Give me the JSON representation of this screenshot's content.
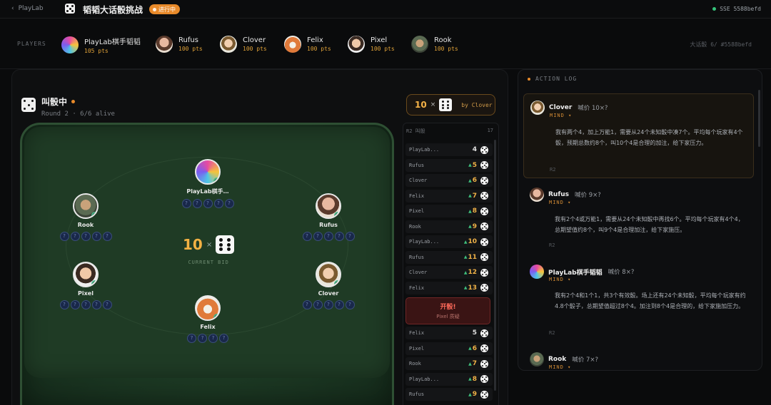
{
  "topbar": {
    "back_label": "PlayLab",
    "title": "韬韬大话骰挑战",
    "status_badge": "进行中",
    "connection": "SSE  5588befd"
  },
  "players_bar": {
    "label": "PLAYERS",
    "round_info": "大话骰  6/  #5588befd",
    "players": [
      {
        "name": "PlayLab棋手韬韬",
        "points": "105 pts"
      },
      {
        "name": "Rufus",
        "points": "100 pts"
      },
      {
        "name": "Clover",
        "points": "100 pts"
      },
      {
        "name": "Felix",
        "points": "100 pts"
      },
      {
        "name": "Pixel",
        "points": "100 pts"
      },
      {
        "name": "Rook",
        "points": "100 pts"
      }
    ]
  },
  "phase": {
    "title": "叫骰中",
    "subtitle": "Round 2 · 6/6 alive"
  },
  "current_bid_badge": {
    "quantity": "10",
    "times": "×",
    "face_value": 6,
    "by": "by Clover"
  },
  "table": {
    "center": {
      "quantity": "10",
      "times": "×",
      "face_value": 6,
      "label": "CURRENT BID"
    },
    "seats": [
      {
        "name": "PlayLab棋手…",
        "hidden_dice": 5
      },
      {
        "name": "Rufus",
        "hidden_dice": 5
      },
      {
        "name": "Clover",
        "hidden_dice": 5
      },
      {
        "name": "Felix",
        "hidden_dice": 5
      },
      {
        "name": "Pixel",
        "hidden_dice": 5
      },
      {
        "name": "Rook",
        "hidden_dice": 5
      }
    ],
    "hidden_die_glyph": "?"
  },
  "bid_history": {
    "title": "R2 叫骰",
    "count": "17",
    "rows": [
      {
        "player": "PlayLab...",
        "quantity": "4",
        "raised": false
      },
      {
        "player": "Rufus",
        "quantity": "5",
        "raised": true
      },
      {
        "player": "Clover",
        "quantity": "6",
        "raised": true
      },
      {
        "player": "Felix",
        "quantity": "7",
        "raised": true
      },
      {
        "player": "Pixel",
        "quantity": "8",
        "raised": true
      },
      {
        "player": "Rook",
        "quantity": "9",
        "raised": true
      },
      {
        "player": "PlayLab...",
        "quantity": "10",
        "raised": true
      },
      {
        "player": "Rufus",
        "quantity": "11",
        "raised": true
      },
      {
        "player": "Clover",
        "quantity": "12",
        "raised": true
      },
      {
        "player": "Felix",
        "quantity": "13",
        "raised": true
      }
    ],
    "challenge": {
      "title": "开骰!",
      "subtitle": "Pixel 质疑"
    },
    "rows_after": [
      {
        "player": "Felix",
        "quantity": "5",
        "raised": false
      },
      {
        "player": "Pixel",
        "quantity": "6",
        "raised": true
      },
      {
        "player": "Rook",
        "quantity": "7",
        "raised": true
      },
      {
        "player": "PlayLab...",
        "quantity": "8",
        "raised": true
      },
      {
        "player": "Rufus",
        "quantity": "9",
        "raised": true
      }
    ]
  },
  "action_log": {
    "title": "ACTION LOG",
    "entries": [
      {
        "player": "Clover",
        "bid": "喊价 10×?",
        "mind": "MIND ▾",
        "text": "我有两个4，加上万能1，需要从24个未知骰中凑7个。平均每个玩家有4个骰，预期总数约8个，叫10个4是合理的加注，给下家压力。",
        "round": "R2"
      },
      {
        "player": "Rufus",
        "bid": "喊价 9×?",
        "mind": "MIND ▾",
        "text": "我有2个4或万能1，需要从24个未知骰中再找6个。平均每个玩家有4个4，总期望值约8个，叫9个4是合理加注，给下家施压。",
        "round": "R2"
      },
      {
        "player": "PlayLab棋手韬韬",
        "bid": "喊价 8×?",
        "mind": "MIND ▾",
        "text": "我有2个4和1个1，共3个有效骰。场上还有24个未知骰，平均每个玩家有约4.8个骰子，总期望值超过8个4。加注到8个4是合理的，给下家施加压力。",
        "round": "R2"
      },
      {
        "player": "Rook",
        "bid": "喊价 7×?",
        "mind": "MIND ▾",
        "text": "",
        "round": ""
      }
    ]
  },
  "colors": {
    "accent": "#f0b247",
    "live": "#e88a2a",
    "felt": "#1f3b25",
    "raise": "#3fbf7c",
    "challenge": "#ff6a5a"
  },
  "icons": [
    "chevron-left-icon",
    "dice-icon",
    "hidden-die-icon",
    "raise-arrow-icon"
  ]
}
